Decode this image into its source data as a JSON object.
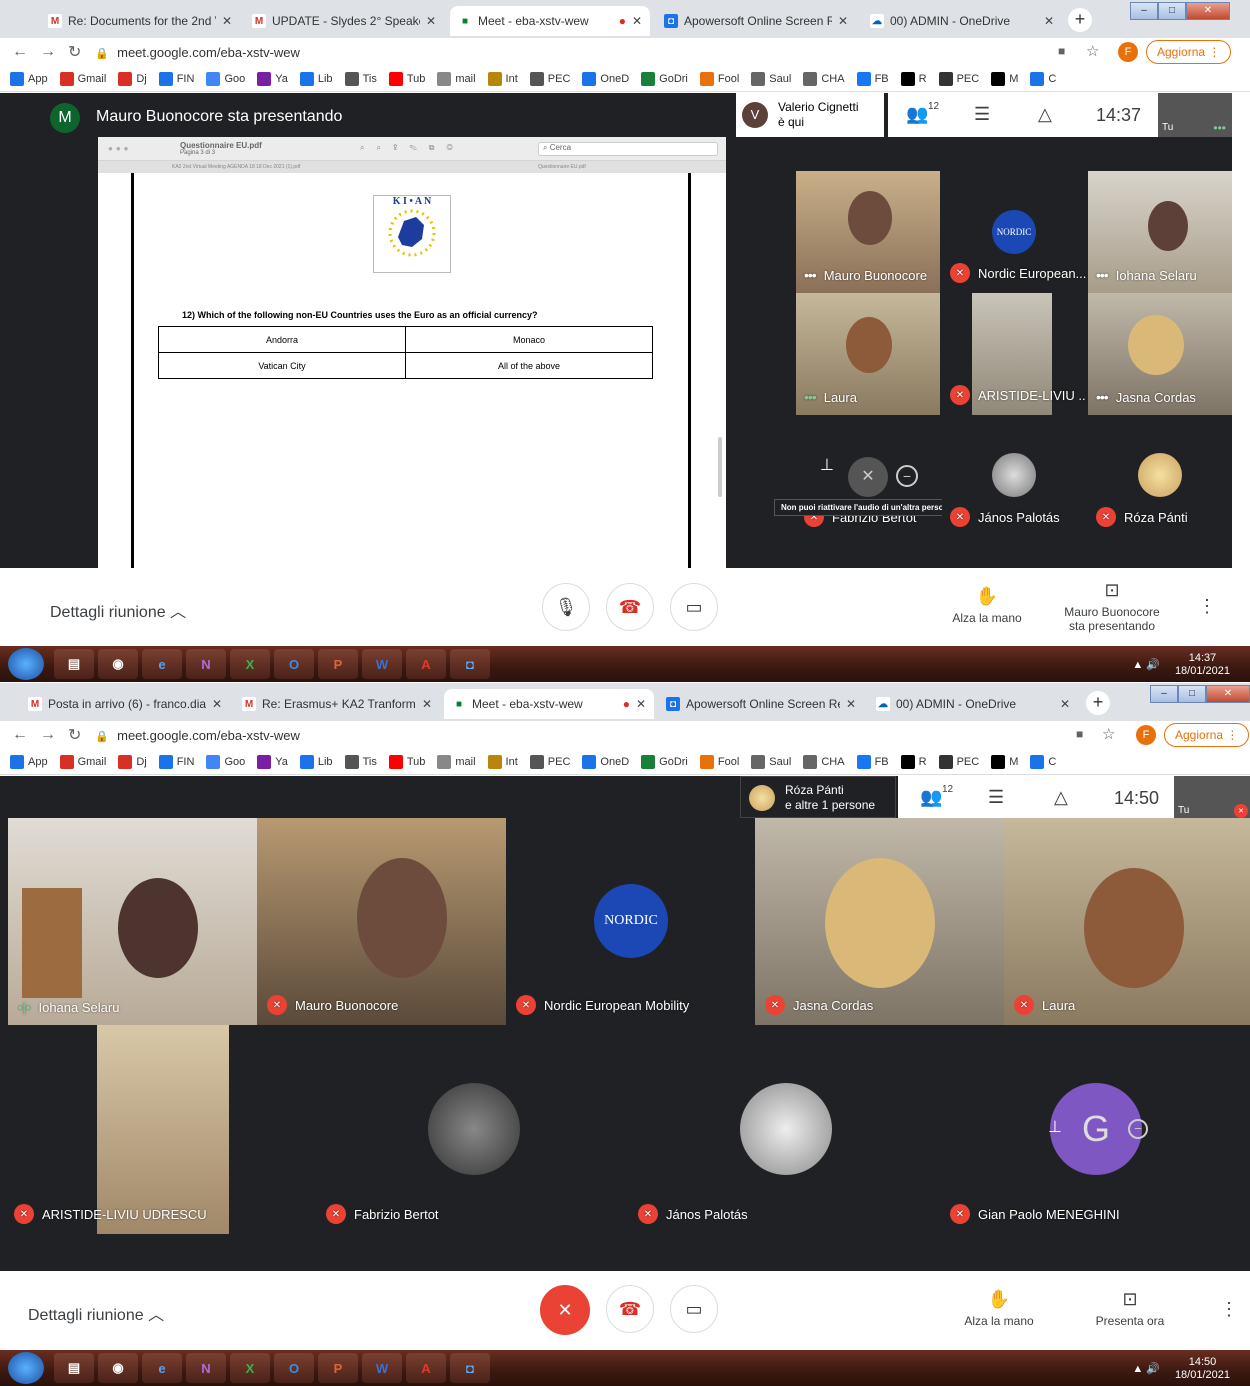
{
  "top": {
    "tabs": [
      {
        "label": "Re: Documents for the 2nd VIRT",
        "fav_color": "#d93025",
        "fav_text": "M"
      },
      {
        "label": "UPDATE - Slydes 2° Speaker - to",
        "fav_color": "#d93025",
        "fav_text": "M"
      },
      {
        "label": "Meet - eba-xstv-wew",
        "fav_color": "#00832d",
        "fav_text": "■"
      },
      {
        "label": "Apowersoft Online Screen Reco",
        "fav_color": "#1a73e8",
        "fav_text": "◘"
      },
      {
        "label": "00) ADMIN - OneDrive",
        "fav_color": "#0364b8",
        "fav_text": "☁"
      }
    ],
    "url": "meet.google.com/eba-xstv-wew",
    "update_label": "Aggiorna",
    "profile_initial": "F",
    "presenter_avatar": "M",
    "presenter_title": "Mauro Buonocore sta presentando",
    "join_avatar": "V",
    "join_name": "Valerio Cignetti",
    "join_sub": "è qui",
    "participants_count": "12",
    "time": "14:37",
    "self_label": "Tu",
    "pdf": {
      "title": "Questionnaire EU.pdf",
      "page": "Pagina 3 di 3",
      "search": "Cerca",
      "tab1": "KA2 2nd Virtual Meeting AGENDA 18 18 Dec 2021 (1).pdf",
      "tab2": "Questionnaire EU.pdf",
      "logo_text": "K I • A N",
      "question": "12) Which of the following non-EU Countries uses the Euro as an official currency?",
      "answers": [
        "Andorra",
        "Monaco",
        "Vatican City",
        "All of the above"
      ]
    },
    "tiles": [
      {
        "name": "Mauro Buonocore",
        "state": "dots"
      },
      {
        "name": "Nordic European...",
        "state": "mute"
      },
      {
        "name": "Iohana Selaru",
        "state": "dots"
      },
      {
        "name": "Laura",
        "state": "dots"
      },
      {
        "name": "ARISTIDE-LIVIU ...",
        "state": "mute"
      },
      {
        "name": "Jasna Cordas",
        "state": "dots"
      },
      {
        "name": "Fabrizio Bertot",
        "state": "mute"
      },
      {
        "name": "János Palotás",
        "state": "mute"
      },
      {
        "name": "Róza Pánti",
        "state": "mute"
      }
    ],
    "tooltip": "Non puoi riattivare l'audio di un'altra persona",
    "nordic_logo": "NORDIC",
    "details": "Dettagli riunione",
    "raise_hand": "Alza la mano",
    "presenting_line1": "Mauro Buonocore",
    "presenting_line2": "sta presentando",
    "clock_time": "14:37",
    "clock_date": "18/01/2021"
  },
  "bottom": {
    "tabs": [
      {
        "label": "Posta in arrivo (6) - franco.dian",
        "fav_color": "#d93025",
        "fav_text": "M"
      },
      {
        "label": "Re: Erasmus+ KA2 Tranformativ",
        "fav_color": "#d93025",
        "fav_text": "M"
      },
      {
        "label": "Meet - eba-xstv-wew",
        "fav_color": "#00832d",
        "fav_text": "■"
      },
      {
        "label": "Apowersoft Online Screen Reco",
        "fav_color": "#1a73e8",
        "fav_text": "◘"
      },
      {
        "label": "00) ADMIN - OneDrive",
        "fav_color": "#0364b8",
        "fav_text": "☁"
      }
    ],
    "url": "meet.google.com/eba-xstv-wew",
    "update_label": "Aggiorna",
    "profile_initial": "F",
    "join_name": "Róza Pánti",
    "join_sub": "e altre 1 persone",
    "participants_count": "12",
    "time": "14:50",
    "self_label": "Tu",
    "tiles": [
      {
        "name": "Iohana Selaru",
        "state": "speaking"
      },
      {
        "name": "Mauro Buonocore",
        "state": "mute"
      },
      {
        "name": "Nordic European Mobility",
        "state": "mute"
      },
      {
        "name": "Jasna Cordas",
        "state": "mute"
      },
      {
        "name": "Laura",
        "state": "mute"
      },
      {
        "name": "ARISTIDE-LIVIU UDRESCU",
        "state": "mute"
      },
      {
        "name": "Fabrizio Bertot",
        "state": "mute"
      },
      {
        "name": "János Palotás",
        "state": "mute"
      },
      {
        "name": "Gian Paolo MENEGHINI",
        "state": "mute"
      }
    ],
    "gian_initial": "G",
    "nordic_logo": "NORDIC",
    "details": "Dettagli riunione",
    "raise_hand": "Alza la mano",
    "present_now": "Presenta ora",
    "clock_time": "14:50",
    "clock_date": "18/01/2021"
  },
  "bookmarks": [
    "App",
    "Gmail",
    "Dj",
    "FIN",
    "Goo",
    "Ya",
    "Lib",
    "Tis",
    "Tub",
    "mail",
    "Int",
    "PEC",
    "OneD",
    "GoDri",
    "Fool",
    "Saul",
    "CHA",
    "FB",
    "R",
    "PEC",
    "M",
    "C"
  ],
  "taskbar_apps": [
    "folder",
    "chrome",
    "ie",
    "onenote",
    "excel",
    "outlook",
    "powerpoint",
    "word",
    "acrobat",
    "recorder"
  ],
  "colors": {
    "meet_bg": "#202124",
    "red": "#ea4335",
    "tile": "#3c4043",
    "brand_orange": "#e8710a"
  }
}
